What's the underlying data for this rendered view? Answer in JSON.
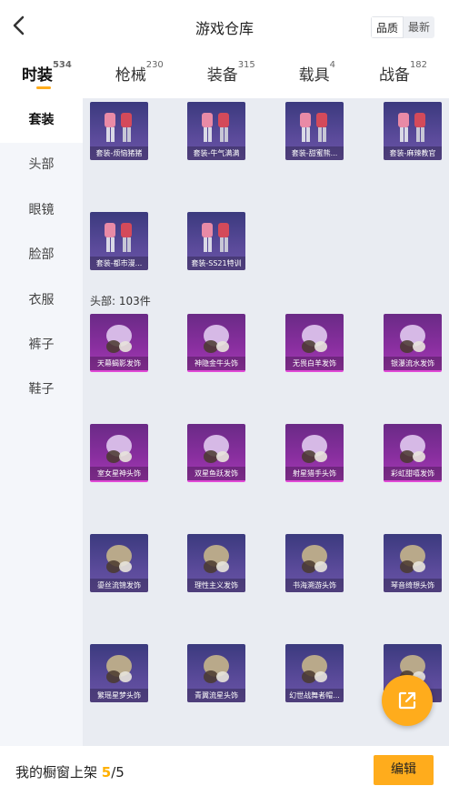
{
  "header": {
    "title": "游戏仓库",
    "sort_options": [
      "品质",
      "最新"
    ],
    "sort_selected": "品质"
  },
  "tabs": [
    {
      "label": "时装",
      "count": "534",
      "active": true
    },
    {
      "label": "枪械",
      "count": "230",
      "active": false
    },
    {
      "label": "装备",
      "count": "315",
      "active": false
    },
    {
      "label": "载具",
      "count": "4",
      "active": false
    },
    {
      "label": "战备",
      "count": "182",
      "active": false
    }
  ],
  "sidebar": {
    "items": [
      {
        "label": "套装",
        "active": true
      },
      {
        "label": "头部",
        "active": false
      },
      {
        "label": "眼镜",
        "active": false
      },
      {
        "label": "脸部",
        "active": false
      },
      {
        "label": "衣服",
        "active": false
      },
      {
        "label": "裤子",
        "active": false
      },
      {
        "label": "鞋子",
        "active": false
      }
    ]
  },
  "suits": [
    {
      "label": "套装-烦恼猪猪",
      "rarity": "purple",
      "icon": "outfit-icon"
    },
    {
      "label": "套装-牛气满满",
      "rarity": "purple",
      "icon": "outfit-icon"
    },
    {
      "label": "套装-甜蜜熊...",
      "rarity": "purple",
      "icon": "outfit-icon"
    },
    {
      "label": "套装-麻辣教官",
      "rarity": "purple",
      "icon": "outfit-icon"
    },
    {
      "label": "套装-都市漫...",
      "rarity": "purple",
      "icon": "outfit-icon"
    },
    {
      "label": "套装-SS21特训",
      "rarity": "purple",
      "icon": "outfit-icon"
    }
  ],
  "head_section": {
    "title": "头部: 103件"
  },
  "head_items": [
    {
      "label": "天幕蝎影发饰",
      "rarity": "pink"
    },
    {
      "label": "神隐金牛头饰",
      "rarity": "pink"
    },
    {
      "label": "无畏白羊发饰",
      "rarity": "pink"
    },
    {
      "label": "银瀑流水发饰",
      "rarity": "pink"
    },
    {
      "label": "室女星神头饰",
      "rarity": "pink"
    },
    {
      "label": "双星鱼跃发饰",
      "rarity": "pink"
    },
    {
      "label": "射星猎手头饰",
      "rarity": "pink"
    },
    {
      "label": "彩虹甜嘻发饰",
      "rarity": "pink"
    },
    {
      "label": "鎏丝流锦发饰",
      "rarity": "purple"
    },
    {
      "label": "理性主义发饰",
      "rarity": "purple"
    },
    {
      "label": "书海溯游头饰",
      "rarity": "purple"
    },
    {
      "label": "琴音绮想头饰",
      "rarity": "purple"
    },
    {
      "label": "繁瑶星梦头饰",
      "rarity": "purple"
    },
    {
      "label": "青翼流星头饰",
      "rarity": "purple"
    },
    {
      "label": "幻世战舞者帽...",
      "rarity": "purple"
    },
    {
      "label": "",
      "rarity": "purple"
    }
  ],
  "footer": {
    "label": "我的橱窗上架",
    "current": "5",
    "total": "/5",
    "edit_label": "编辑"
  },
  "colors": {
    "accent": "#ffac1c",
    "purple_rarity": "#5a4a9a",
    "pink_rarity": "#8a2fa0"
  }
}
